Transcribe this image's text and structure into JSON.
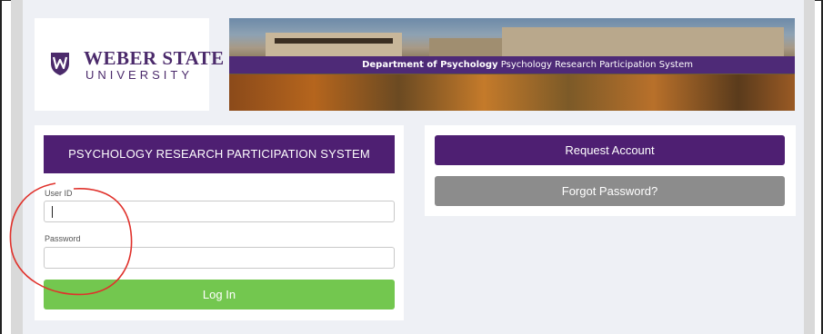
{
  "logo": {
    "line1": "WEBER STATE",
    "line2": "UNIVERSITY",
    "shield_icon": "university-shield-icon",
    "brand_color": "#4b2a6b"
  },
  "banner": {
    "department": "Department of Psychology",
    "system": " Psychology Research Participation System",
    "strip_color": "#4e2a77"
  },
  "login": {
    "header": "PSYCHOLOGY RESEARCH PARTICIPATION SYSTEM",
    "user_label": "User ID",
    "user_value": "",
    "password_label": "Password",
    "password_value": "",
    "button": "Log In",
    "header_color": "#4e1f72",
    "button_color": "#73c74f"
  },
  "account": {
    "request_button": "Request Account",
    "forgot_button": "Forgot Password?",
    "request_color": "#4e1f72",
    "forgot_color": "#8c8c8c"
  },
  "annotation": {
    "type": "red-circle",
    "color": "#e0312b"
  }
}
